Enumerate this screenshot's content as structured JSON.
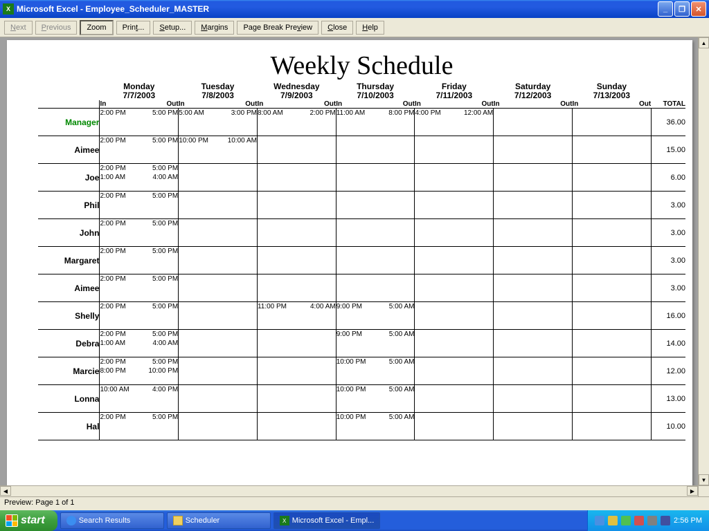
{
  "window": {
    "app": "Microsoft Excel",
    "doc": "Employee_Scheduler_MASTER"
  },
  "toolbar": {
    "next": "Next",
    "previous": "Previous",
    "zoom": "Zoom",
    "print": "Print...",
    "setup": "Setup...",
    "margins": "Margins",
    "page_break": "Page Break Preview",
    "close": "Close",
    "help": "Help"
  },
  "status": "Preview: Page 1 of 1",
  "schedule": {
    "title": "Weekly Schedule",
    "total_label": "TOTAL",
    "in_label": "In",
    "out_label": "Out",
    "days": [
      {
        "name": "Monday",
        "date": "7/7/2003"
      },
      {
        "name": "Tuesday",
        "date": "7/8/2003"
      },
      {
        "name": "Wednesday",
        "date": "7/9/2003"
      },
      {
        "name": "Thursday",
        "date": "7/10/2003"
      },
      {
        "name": "Friday",
        "date": "7/11/2003"
      },
      {
        "name": "Saturday",
        "date": "7/12/2003"
      },
      {
        "name": "Sunday",
        "date": "7/13/2003"
      }
    ],
    "employees": [
      {
        "name": "Manager",
        "highlight": true,
        "total": "36.00",
        "shifts": [
          [
            {
              "in": "2:00 PM",
              "out": "5:00 PM"
            }
          ],
          [
            {
              "in": "5:00 AM",
              "out": "3:00 PM"
            }
          ],
          [
            {
              "in": "8:00 AM",
              "out": "2:00 PM"
            }
          ],
          [
            {
              "in": "11:00 AM",
              "out": "8:00 PM"
            }
          ],
          [
            {
              "in": "4:00 PM",
              "out": "12:00 AM"
            }
          ],
          [],
          []
        ]
      },
      {
        "name": "Aimee",
        "total": "15.00",
        "shifts": [
          [
            {
              "in": "2:00 PM",
              "out": "5:00 PM"
            }
          ],
          [
            {
              "in": "10:00 PM",
              "out": "10:00 AM"
            }
          ],
          [],
          [],
          [],
          [],
          []
        ]
      },
      {
        "name": "Joe",
        "total": "6.00",
        "shifts": [
          [
            {
              "in": "2:00 PM",
              "out": "5:00 PM"
            },
            {
              "in": "1:00 AM",
              "out": "4:00 AM"
            }
          ],
          [],
          [],
          [],
          [],
          [],
          []
        ]
      },
      {
        "name": "Phil",
        "total": "3.00",
        "shifts": [
          [
            {
              "in": "2:00 PM",
              "out": "5:00 PM"
            }
          ],
          [],
          [],
          [],
          [],
          [],
          []
        ]
      },
      {
        "name": "John",
        "total": "3.00",
        "shifts": [
          [
            {
              "in": "2:00 PM",
              "out": "5:00 PM"
            }
          ],
          [],
          [],
          [],
          [],
          [],
          []
        ]
      },
      {
        "name": "Margaret",
        "total": "3.00",
        "shifts": [
          [
            {
              "in": "2:00 PM",
              "out": "5:00 PM"
            }
          ],
          [],
          [],
          [],
          [],
          [],
          []
        ]
      },
      {
        "name": "Aimee",
        "total": "3.00",
        "shifts": [
          [
            {
              "in": "2:00 PM",
              "out": "5:00 PM"
            }
          ],
          [],
          [],
          [],
          [],
          [],
          []
        ]
      },
      {
        "name": "Shelly",
        "total": "16.00",
        "shifts": [
          [
            {
              "in": "2:00 PM",
              "out": "5:00 PM"
            }
          ],
          [],
          [
            {
              "in": "11:00 PM",
              "out": "4:00 AM"
            }
          ],
          [
            {
              "in": "9:00 PM",
              "out": "5:00 AM"
            }
          ],
          [],
          [],
          []
        ]
      },
      {
        "name": "Debra",
        "total": "14.00",
        "shifts": [
          [
            {
              "in": "2:00 PM",
              "out": "5:00 PM"
            },
            {
              "in": "1:00 AM",
              "out": "4:00 AM"
            }
          ],
          [],
          [],
          [
            {
              "in": "9:00 PM",
              "out": "5:00 AM"
            }
          ],
          [],
          [],
          []
        ]
      },
      {
        "name": "Marcie",
        "total": "12.00",
        "shifts": [
          [
            {
              "in": "2:00 PM",
              "out": "5:00 PM"
            },
            {
              "in": "8:00 PM",
              "out": "10:00 PM"
            }
          ],
          [],
          [],
          [
            {
              "in": "10:00 PM",
              "out": "5:00 AM"
            }
          ],
          [],
          [],
          []
        ]
      },
      {
        "name": "Lonna",
        "total": "13.00",
        "shifts": [
          [
            {
              "in": "10:00 AM",
              "out": "4:00 PM"
            }
          ],
          [],
          [],
          [
            {
              "in": "10:00 PM",
              "out": "5:00 AM"
            }
          ],
          [],
          [],
          []
        ]
      },
      {
        "name": "Hal",
        "total": "10.00",
        "shifts": [
          [
            {
              "in": "2:00 PM",
              "out": "5:00 PM"
            }
          ],
          [],
          [],
          [
            {
              "in": "10:00 PM",
              "out": "5:00 AM"
            }
          ],
          [],
          [],
          []
        ]
      }
    ]
  },
  "taskbar": {
    "start": "start",
    "items": [
      {
        "label": "Search Results",
        "icon": "ie"
      },
      {
        "label": "Scheduler",
        "icon": "folder"
      },
      {
        "label": "Microsoft Excel - Empl...",
        "icon": "excel",
        "active": true
      }
    ],
    "clock": "2:56 PM"
  }
}
